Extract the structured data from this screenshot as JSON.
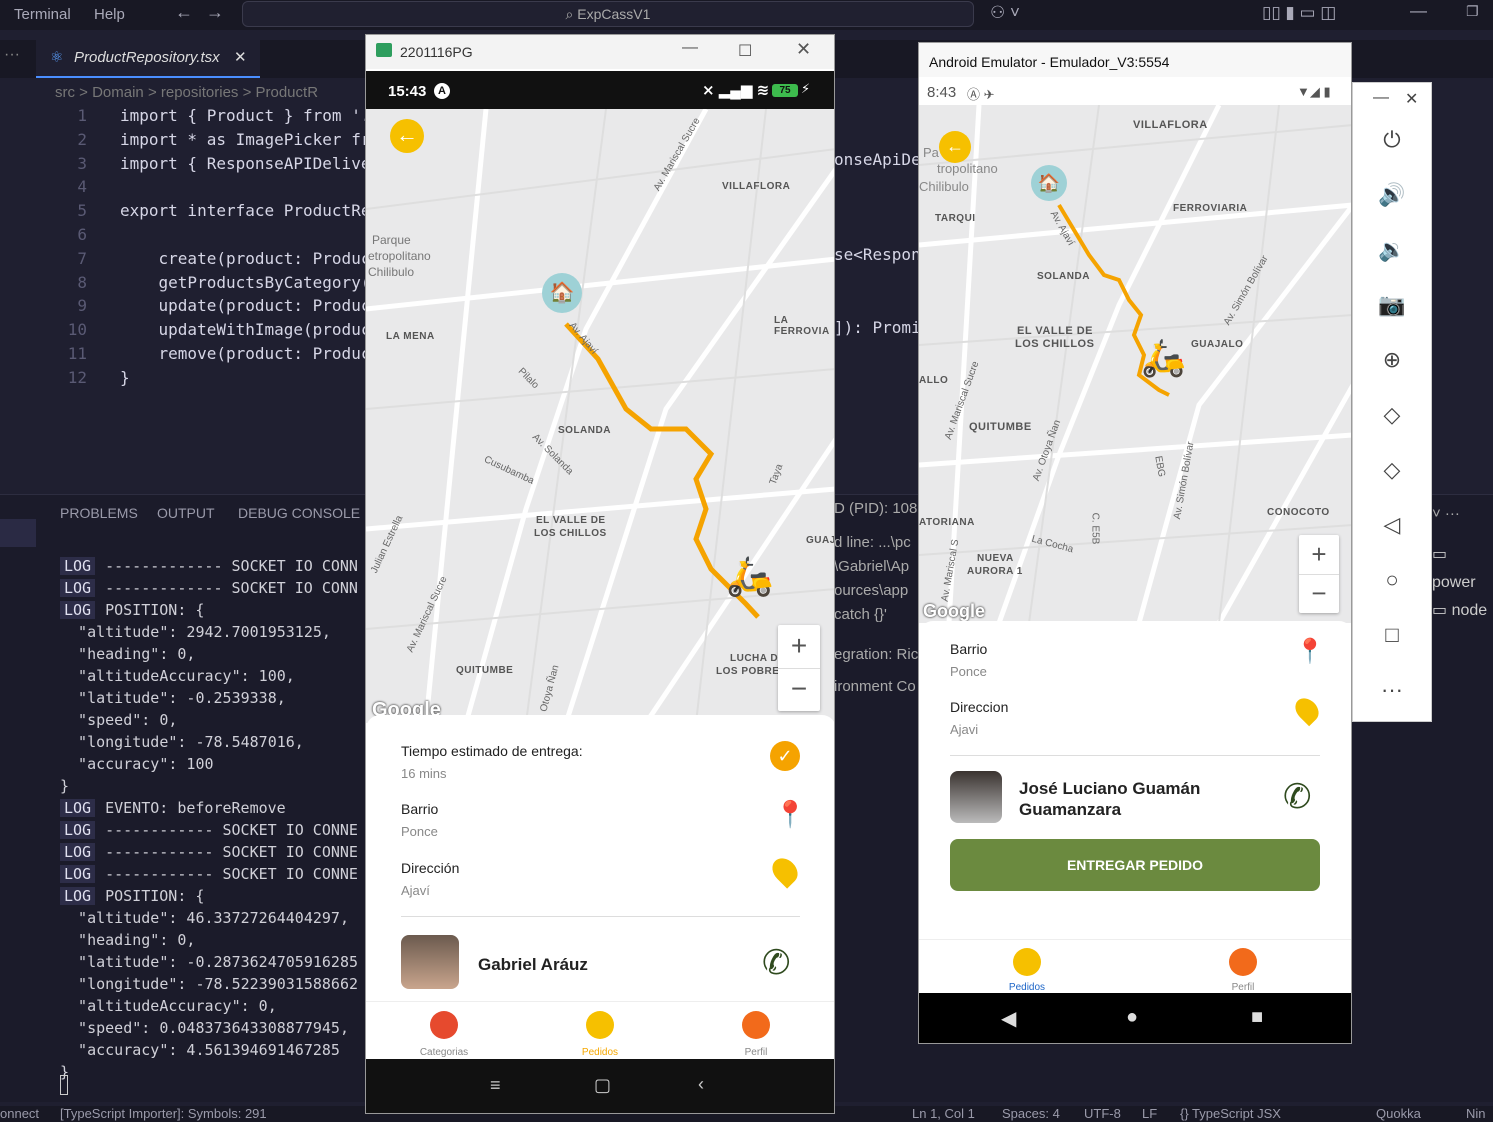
{
  "vscode": {
    "menu": [
      "Terminal",
      "Help"
    ],
    "command_center": "ExpCassV1",
    "tab": "ProductRepository.tsx",
    "breadcrumb": "src > Domain > repositories > ProductR",
    "code_lines": [
      {
        "n": "1",
        "t": "import { Product } from '."
      },
      {
        "n": "2",
        "t": "import * as ImagePicker fr"
      },
      {
        "n": "3",
        "t": "import { ResponseAPIDelive"
      },
      {
        "n": "4",
        "t": ""
      },
      {
        "n": "5",
        "t": "export interface ProductRe"
      },
      {
        "n": "6",
        "t": ""
      },
      {
        "n": "7",
        "t": "    create(product: Produc"
      },
      {
        "n": "8",
        "t": "    getProductsByCategory("
      },
      {
        "n": "9",
        "t": "    update(product: Produc"
      },
      {
        "n": "10",
        "t": "    updateWithImage(produc"
      },
      {
        "n": "11",
        "t": "    remove(product: Produc"
      },
      {
        "n": "12",
        "t": "}"
      }
    ],
    "right_code": [
      "onseApiDe",
      "se<Respon",
      "]): Promi"
    ],
    "panel_tabs": [
      "PROBLEMS",
      "OUTPUT",
      "DEBUG CONSOLE"
    ],
    "terminal": [
      {
        "log": "LOG",
        "t": "------------- SOCKET IO CONN"
      },
      {
        "log": "LOG",
        "t": "------------- SOCKET IO CONN"
      },
      {
        "log": "LOG",
        "t": "POSITION: {"
      },
      {
        "log": "",
        "t": "  \"altitude\": 2942.7001953125,"
      },
      {
        "log": "",
        "t": "  \"heading\": 0,"
      },
      {
        "log": "",
        "t": "  \"altitudeAccuracy\": 100,"
      },
      {
        "log": "",
        "t": "  \"latitude\": -0.2539338,"
      },
      {
        "log": "",
        "t": "  \"speed\": 0,"
      },
      {
        "log": "",
        "t": "  \"longitude\": -78.5487016,"
      },
      {
        "log": "",
        "t": "  \"accuracy\": 100"
      },
      {
        "log": "",
        "t": "}"
      },
      {
        "log": "LOG",
        "t": "EVENTO: beforeRemove"
      },
      {
        "log": "LOG",
        "t": "------------ SOCKET IO CONNE"
      },
      {
        "log": "LOG",
        "t": "------------ SOCKET IO CONNE"
      },
      {
        "log": "LOG",
        "t": "------------ SOCKET IO CONNE"
      },
      {
        "log": "LOG",
        "t": "POSITION: {"
      },
      {
        "log": "",
        "t": "  \"altitude\": 46.33727264404297,"
      },
      {
        "log": "",
        "t": "  \"heading\": 0,"
      },
      {
        "log": "",
        "t": "  \"latitude\": -0.2873624705916285"
      },
      {
        "log": "",
        "t": "  \"longitude\": -78.52239031588662"
      },
      {
        "log": "",
        "t": "  \"altitudeAccuracy\": 0,"
      },
      {
        "log": "",
        "t": "  \"speed\": 0.048373643308877945,"
      },
      {
        "log": "",
        "t": "  \"accuracy\": 4.561394691467285"
      },
      {
        "log": "",
        "t": "}"
      }
    ],
    "right_terminal": [
      "D (PID): 108",
      "d line: ...\\pc",
      "\\Gabriel\\Ap",
      "ources\\app",
      "catch {}'",
      "egration: Ric",
      "ironment Co"
    ],
    "right_panel": [
      "power",
      "node"
    ],
    "status_left": [
      "onnect",
      "[TypeScript Importer]: Symbols: 291"
    ],
    "status_right": [
      "Ln 1, Col 1",
      "Spaces: 4",
      "UTF-8",
      "LF",
      "{} TypeScript JSX",
      "Quokka",
      "Nin"
    ]
  },
  "phone1": {
    "window_title": "2201116PG",
    "time": "15:43",
    "battery": "75",
    "map_labels": [
      "VILLAFLORA",
      "LA MENA",
      "LA FERROVIA",
      "SOLANDA",
      "EL VALLE DE",
      "LOS CHILLOS",
      "QUITUMBE",
      "LUCHA DE",
      "LOS POBRES",
      "GUAJ"
    ],
    "map_streets": [
      "Av. Mariscal Sucre",
      "Parque",
      "etropolitano",
      "Chilibulo",
      "Av. Ajaví",
      "Pilalo",
      "Av. Solanda",
      "Cusubamba",
      "Taya",
      "Julian Estrella",
      "Av. Mariscal Sucre",
      "Otoya Ñan"
    ],
    "google": "Google",
    "eta_label": "Tiempo estimado de entrega:",
    "eta_value": "16 mins",
    "barrio_label": "Barrio",
    "barrio_value": "Ponce",
    "direccion_label": "Dirección",
    "direccion_value": "Ajaví",
    "client_name": "Gabriel Aráuz",
    "nav": [
      "Categorias",
      "Pedidos",
      "Perfil"
    ]
  },
  "phone2": {
    "window_title": "Android Emulator - Emulador_V3:5554",
    "time": "8:43",
    "map_labels": [
      "VILLAFLORA",
      "FERROVIARIA",
      "TARQUI",
      "SOLANDA",
      "EL VALLE DE",
      "LOS CHILLOS",
      "GUAJALO",
      "QUITUMBE",
      "ATORIANA",
      "NUEVA",
      "AURORA 1",
      "CONOCOTO",
      "ALLO"
    ],
    "map_streets": [
      "Pa",
      "tropolitano",
      "Chilibulo",
      "Av. Ajaví",
      "Av. Simón Bolívar",
      "Av. Mariscal Sucre",
      "Av. Otoya Ñan",
      "EBG",
      "Av. Simón Bolívar",
      "C. E5B",
      "La Cocha",
      "Av. Mariscal S"
    ],
    "google": "Google",
    "barrio_label": "Barrio",
    "barrio_value": "Ponce",
    "direccion_label": "Direccion",
    "direccion_value": "Ajavi",
    "client_name_1": "José Luciano Guamán",
    "client_name_2": "Guamanzara",
    "button": "ENTREGAR PEDIDO",
    "nav": [
      "Pedidos",
      "Perfil"
    ]
  },
  "colors": {
    "accent_yellow": "#f6c000",
    "route": "#f5a300",
    "button_green": "#6b8a3f",
    "nav_active": "#f6a800"
  }
}
